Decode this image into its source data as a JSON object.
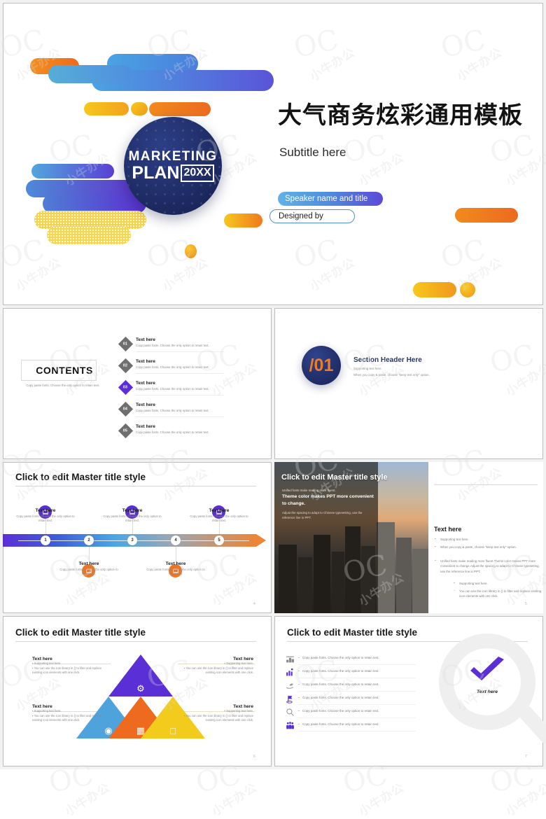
{
  "hero": {
    "title": "大气商务炫彩通用模板",
    "subtitle": "Subtitle here",
    "logo_line1": "MARKETING",
    "logo_line2": "PLAN",
    "logo_year": "20XX",
    "speaker_pill": "Speaker name and title",
    "designed_pill": "Designed by",
    "accent_purple": "#5b2fd6",
    "accent_orange": "#ee7522",
    "accent_blue": "#49a7e5",
    "accent_navy": "#1b2a63"
  },
  "watermark": {
    "text": "小牛办公",
    "glyph": "OC"
  },
  "contents": {
    "heading": "CONTENTS",
    "note": "Copy paste fonts. Choose the only option to retain text.",
    "items": [
      {
        "num": "01",
        "title": "Text here",
        "desc": "Copy paste fonts. Choose the only option to retain text.",
        "active": false
      },
      {
        "num": "02",
        "title": "Text here",
        "desc": "Copy paste fonts. Choose the only option to retain text.",
        "active": false
      },
      {
        "num": "03",
        "title": "Text here",
        "desc": "Copy paste fonts. Choose the only option to retain text.",
        "active": true
      },
      {
        "num": "04",
        "title": "Text here",
        "desc": "Copy paste fonts. Choose the only option to retain text.",
        "active": false
      },
      {
        "num": "05",
        "title": "Text here",
        "desc": "Copy paste fonts. Choose the only option to retain text.",
        "active": false
      }
    ]
  },
  "section": {
    "number": "/01",
    "heading": "Section Header Here",
    "support": "Supporting text here.",
    "note": "When you copy & paste, choose \"keep text only\" option."
  },
  "timeline": {
    "title": "Click to edit Master title style",
    "page": "4",
    "steps": [
      {
        "num": "1",
        "icon": "laptop-icon",
        "position": "up",
        "title": "Text here",
        "desc": "Copy paste fonts. Choose the only option to retain text."
      },
      {
        "num": "2",
        "icon": "laptop-icon",
        "position": "down",
        "title": "Text here",
        "desc": "Copy paste fonts. Choose the only option to retain text."
      },
      {
        "num": "3",
        "icon": "laptop-icon",
        "position": "up",
        "title": "Text here",
        "desc": "Copy paste fonts. Choose the only option to retain text."
      },
      {
        "num": "4",
        "icon": "laptop-icon",
        "position": "down",
        "title": "Text here",
        "desc": "Copy paste fonts. Choose the only option to retain text."
      },
      {
        "num": "5",
        "icon": "laptop-icon",
        "position": "up",
        "title": "Text here",
        "desc": "Copy paste fonts. Choose the only option to retain text."
      }
    ]
  },
  "city": {
    "title": "Click to edit Master title style",
    "lead": "Unified fonts make reading more fluent.",
    "emphasis": "Theme color makes PPT more convenient to change.",
    "body": "Adjust the spacing to adapt to Chinese typesetting, use the reference line in PPT.",
    "panel_heading": "Text here",
    "bullets": [
      "Supporting text here.",
      "When you copy & paste, choose \"keep text only\" option."
    ],
    "paragraph": "Unified fonts make reading more fluent.Theme color makes PPT more convenient to change.Adjust the spacing to adapt to Chinese typesetting, use the reference line in PPT.",
    "sub_bullets": [
      "Supporting text here.",
      "You can use the icon library in  () to filter and replace existing icon elements with one click."
    ],
    "page": "5"
  },
  "pyramid": {
    "title": "Click to edit Master title style",
    "page": "6",
    "segments": [
      {
        "icon": "gear-icon",
        "glyph": "⚙",
        "color": "#5b2fd6",
        "name": "top"
      },
      {
        "icon": "windows-icon",
        "glyph": "⊞",
        "color": "#ee6a1f",
        "name": "center"
      },
      {
        "icon": "aperture-icon",
        "glyph": "◎",
        "color": "#4fa3dd",
        "name": "left"
      },
      {
        "icon": "apple-icon",
        "glyph": "●",
        "color": "#f2cb1d",
        "name": "right"
      }
    ],
    "callouts": [
      {
        "title": "Text here",
        "b1": "Supporting text here",
        "b2": "You can use the icon library in  () to filter and replace existing icon elements with one click.",
        "side": "left"
      },
      {
        "title": "Text here",
        "b1": "Supporting text here.",
        "b2": "You can use the icon library in  () to filter and replace existing icon elements with one click.",
        "side": "right"
      },
      {
        "title": "Text here",
        "b1": "Supporting text here.",
        "b2": "You can use the icon library in  () to filter and replace existing icon elements with one click.",
        "side": "left"
      },
      {
        "title": "Text here",
        "b1": "Supporting text here.",
        "b2": "You can use the icon library in  () to filter and replace existing icon elements with one click.",
        "side": "right"
      }
    ]
  },
  "magnifier": {
    "title": "Click to edit Master title style",
    "page": "7",
    "badge_text": "Text here",
    "rows": [
      {
        "icon": "podium-icon",
        "glyph": "☷",
        "text": "Copy paste fonts. Choose the only option to retain text."
      },
      {
        "icon": "bar-chart-person-icon",
        "glyph": "█",
        "text": "Copy paste fonts. Choose the only option to retain text."
      },
      {
        "icon": "hand-leaf-icon",
        "glyph": "✋",
        "text": "Copy paste fonts. Choose the only option to retain text."
      },
      {
        "icon": "flag-icon",
        "glyph": "⚑",
        "text": "Copy paste fonts. Choose the only option to retain text."
      },
      {
        "icon": "search-icon",
        "glyph": "⚲",
        "text": "Copy paste fonts. Choose the only option to retain text."
      },
      {
        "icon": "people-group-icon",
        "glyph": "♟",
        "text": "Copy paste fonts. Choose the only option to retain text."
      }
    ]
  }
}
